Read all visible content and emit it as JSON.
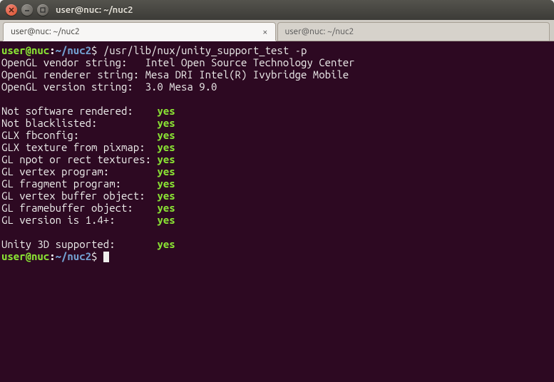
{
  "window": {
    "title": "user@nuc: ~/nuc2"
  },
  "tabs": [
    {
      "label": "user@nuc: ~/nuc2",
      "active": true
    },
    {
      "label": "user@nuc: ~/nuc2",
      "active": false
    }
  ],
  "prompt": {
    "userhost": "user@nuc",
    "sep": ":",
    "path": "~/nuc2",
    "symbol": "$"
  },
  "command": "/usr/lib/nux/unity_support_test -p",
  "info_lines": [
    {
      "label": "OpenGL vendor string:  ",
      "value": "Intel Open Source Technology Center"
    },
    {
      "label": "OpenGL renderer string:",
      "value": "Mesa DRI Intel(R) Ivybridge Mobile "
    },
    {
      "label": "OpenGL version string: ",
      "value": "3.0 Mesa 9.0"
    }
  ],
  "checks": [
    {
      "label": "Not software rendered:   ",
      "result": "yes"
    },
    {
      "label": "Not blacklisted:         ",
      "result": "yes"
    },
    {
      "label": "GLX fbconfig:            ",
      "result": "yes"
    },
    {
      "label": "GLX texture from pixmap: ",
      "result": "yes"
    },
    {
      "label": "GL npot or rect textures:",
      "result": "yes"
    },
    {
      "label": "GL vertex program:       ",
      "result": "yes"
    },
    {
      "label": "GL fragment program:     ",
      "result": "yes"
    },
    {
      "label": "GL vertex buffer object: ",
      "result": "yes"
    },
    {
      "label": "GL framebuffer object:   ",
      "result": "yes"
    },
    {
      "label": "GL version is 1.4+:      ",
      "result": "yes"
    }
  ],
  "summary": {
    "label": "Unity 3D supported:      ",
    "result": "yes"
  },
  "colors": {
    "terminal_bg": "#2d0922",
    "result_green": "#8ae234",
    "prompt_green": "#8ae234",
    "path_blue": "#729fcf"
  }
}
